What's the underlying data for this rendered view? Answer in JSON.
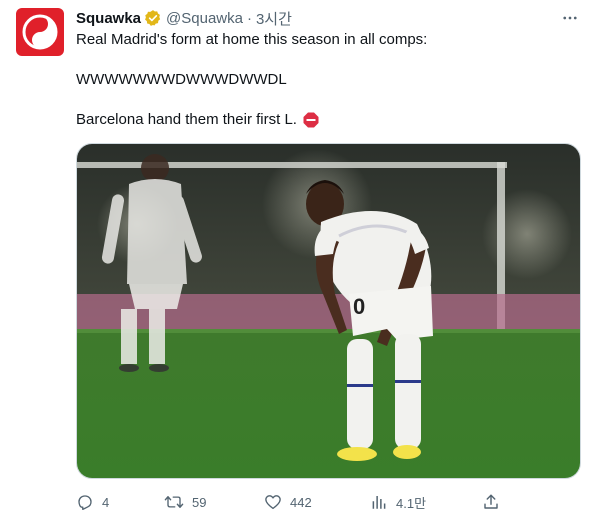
{
  "author": {
    "display_name": "Squawka",
    "handle": "@Squawka",
    "time_separator": "·",
    "time": "3시간",
    "avatar_icon": "squawka-logo-icon",
    "verified_icon": "verified-badge-icon",
    "brand_color": "#e0202a",
    "verified_color": "#e2b719"
  },
  "tweet": {
    "line1": "Real Madrid's form at home this season in all comps:",
    "line2": "WWWWWWWDWWWDWWDL",
    "line3": "Barcelona hand them their first L.",
    "line3_emoji": "stop-sign-emoji",
    "media_description_icon": "football-player-photo"
  },
  "actions": {
    "reply_count": "4",
    "retweet_count": "59",
    "like_count": "442",
    "views_count": "4.1만",
    "reply_icon": "reply-icon",
    "retweet_icon": "retweet-icon",
    "like_icon": "heart-icon",
    "views_icon": "views-chart-icon",
    "share_icon": "share-icon",
    "more_icon": "more-dots-icon"
  },
  "colors": {
    "text": "#0f1419",
    "secondary": "#536471",
    "border": "#cfd9de"
  }
}
